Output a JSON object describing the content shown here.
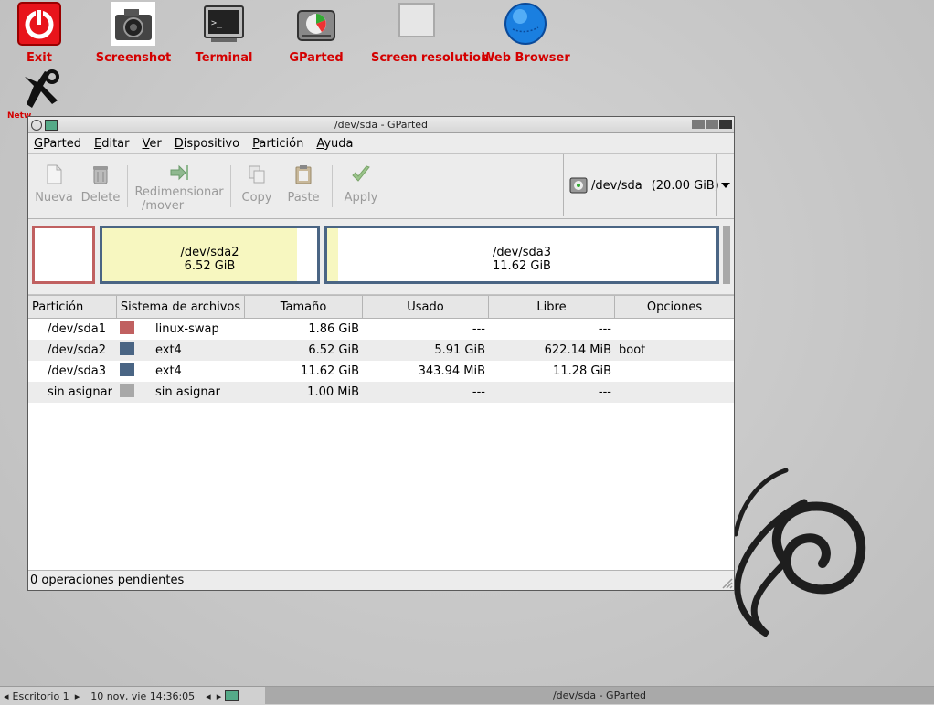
{
  "desktop": {
    "icons": [
      {
        "label": "Exit"
      },
      {
        "label": "Screenshot"
      },
      {
        "label": "Terminal"
      },
      {
        "label": "GParted"
      },
      {
        "label": "Screen resolution"
      },
      {
        "label": "Web Browser"
      },
      {
        "label": "Netw"
      }
    ]
  },
  "window": {
    "title": "/dev/sda - GParted",
    "menu": [
      "GParted",
      "Editar",
      "Ver",
      "Dispositivo",
      "Partición",
      "Ayuda"
    ],
    "toolbar": {
      "new": "Nueva",
      "delete": "Delete",
      "resize_line1": "Redimensionar",
      "resize_line2": "/mover",
      "copy": "Copy",
      "paste": "Paste",
      "apply": "Apply"
    },
    "device_selector": {
      "device": "/dev/sda",
      "size": "(20.00 GiB)"
    },
    "disk_map": [
      {
        "name": "",
        "size": ""
      },
      {
        "name": "/dev/sda2",
        "size": "6.52 GiB"
      },
      {
        "name": "/dev/sda3",
        "size": "11.62 GiB"
      }
    ],
    "table": {
      "headers": [
        "Partición",
        "Sistema de archivos",
        "Tamaño",
        "Usado",
        "Libre",
        "Opciones"
      ],
      "rows": [
        {
          "partition": "/dev/sda1",
          "color": "#c06060",
          "fs": "linux-swap",
          "size": "1.86 GiB",
          "used": "---",
          "free": "---",
          "flags": ""
        },
        {
          "partition": "/dev/sda2",
          "color": "#4a6584",
          "fs": "ext4",
          "size": "6.52 GiB",
          "used": "5.91 GiB",
          "free": "622.14 MiB",
          "flags": "boot"
        },
        {
          "partition": "/dev/sda3",
          "color": "#4a6584",
          "fs": "ext4",
          "size": "11.62 GiB",
          "used": "343.94 MiB",
          "free": "11.28 GiB",
          "flags": ""
        },
        {
          "partition": "sin asignar",
          "color": "#a8a8a8",
          "fs": "sin asignar",
          "size": "1.00 MiB",
          "used": "---",
          "free": "---",
          "flags": ""
        }
      ]
    },
    "status": "0 operaciones pendientes"
  },
  "taskbar": {
    "workspace": "Escritorio 1",
    "clock": "10 nov, vie 14:36:05",
    "task_title": "/dev/sda - GParted"
  },
  "colors": {
    "swap": "#c06060",
    "ext4": "#4a6584",
    "unallocated": "#a8a8a8",
    "used_fill": "#f7f7c0",
    "label_red": "#d40000"
  }
}
